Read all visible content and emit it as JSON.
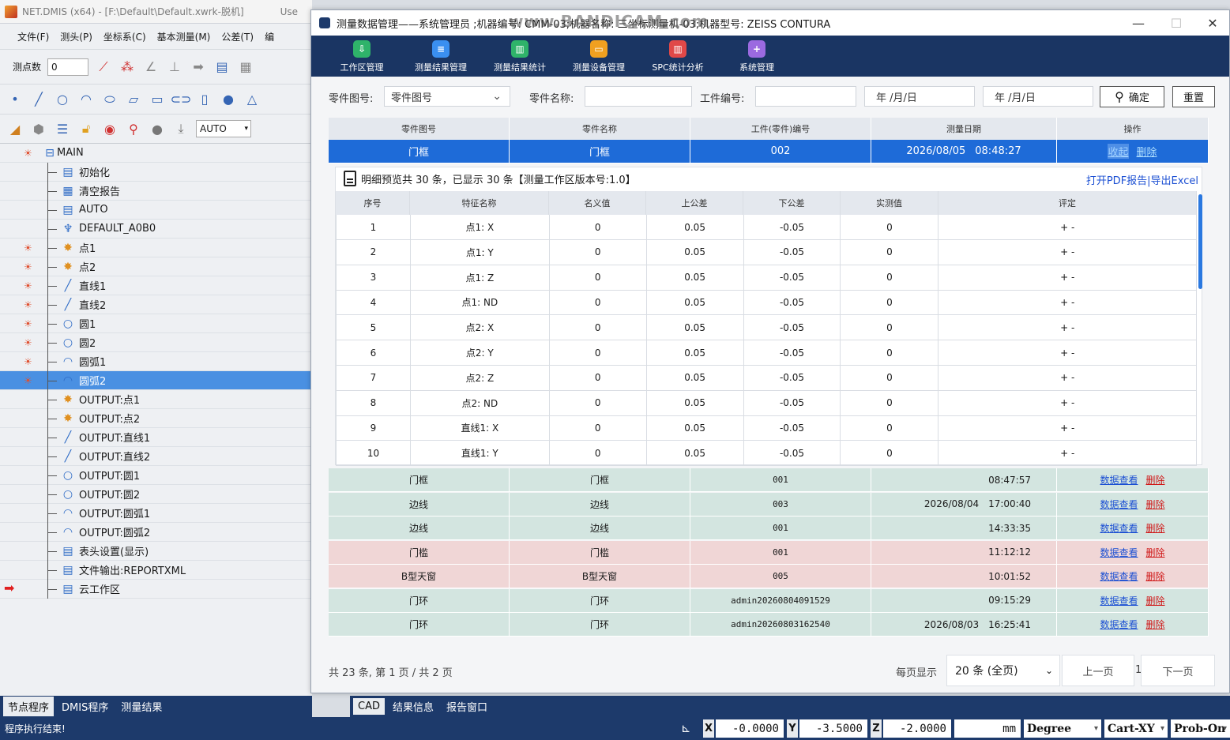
{
  "app": {
    "title": "NET.DMIS (x64) - [F:\\Default\\Default.xwrk-脱机]",
    "title_tail": "Use",
    "menu": [
      "文件(F)",
      "测头(P)",
      "坐标系(C)",
      "基本测量(M)",
      "公差(T)",
      "编"
    ],
    "toolbar": {
      "point_count_label": "测点数",
      "point_count_value": "0",
      "auto_value": "AUTO"
    }
  },
  "tree": {
    "items": [
      {
        "label": "MAIN",
        "icon": "minus-box-icon"
      },
      {
        "label": "初始化",
        "icon": "init-icon"
      },
      {
        "label": "清空报告",
        "icon": "clear-report-icon"
      },
      {
        "label": "AUTO",
        "icon": "mode-icon"
      },
      {
        "label": "DEFAULT_A0B0",
        "icon": "probe-icon"
      },
      {
        "label": "点1",
        "icon": "point-icon"
      },
      {
        "label": "点2",
        "icon": "point-icon"
      },
      {
        "label": "直线1",
        "icon": "line-icon"
      },
      {
        "label": "直线2",
        "icon": "line-icon"
      },
      {
        "label": "圆1",
        "icon": "circle-icon"
      },
      {
        "label": "圆2",
        "icon": "circle-icon"
      },
      {
        "label": "圆弧1",
        "icon": "arc-icon"
      },
      {
        "label": "圆弧2",
        "icon": "arc-icon"
      },
      {
        "label": "OUTPUT:点1",
        "icon": "point-icon"
      },
      {
        "label": "OUTPUT:点2",
        "icon": "point-icon"
      },
      {
        "label": "OUTPUT:直线1",
        "icon": "line-icon"
      },
      {
        "label": "OUTPUT:直线2",
        "icon": "line-icon"
      },
      {
        "label": "OUTPUT:圆1",
        "icon": "circle-icon"
      },
      {
        "label": "OUTPUT:圆2",
        "icon": "circle-icon"
      },
      {
        "label": "OUTPUT:圆弧1",
        "icon": "arc-icon"
      },
      {
        "label": "OUTPUT:圆弧2",
        "icon": "arc-icon"
      },
      {
        "label": "表头设置(显示)",
        "icon": "header-icon"
      },
      {
        "label": "文件输出:REPORTXML",
        "icon": "file-output-icon"
      },
      {
        "label": "云工作区",
        "icon": "cloud-icon"
      }
    ]
  },
  "bottom_tabs_left": [
    "节点程序",
    "DMIS程序",
    "测量结果"
  ],
  "bottom_tabs_right": [
    "CAD",
    "结果信息",
    "报告窗口"
  ],
  "status": {
    "message": "程序执行结束!",
    "x_label": "X",
    "x_value": "-0.0000",
    "y_label": "Y",
    "y_value": "-3.5000",
    "z_label": "Z",
    "z_value": "-2.0000",
    "unit": "mm",
    "angle": "Degree",
    "coord": "Cart-XY",
    "probe": "Prob-On"
  },
  "dialog": {
    "title": "测量数据管理——系统管理员 ;机器编号: CMM-03;机器名称: 三坐标测量机-03;机器型号: ZEISS CONTURA",
    "watermark": "www.BANDICAM.com",
    "toolbar": [
      {
        "label": "工作区管理",
        "color": "#2fb36a",
        "icon": "⇩"
      },
      {
        "label": "测量结果管理",
        "color": "#3a8ff0",
        "icon": "≡"
      },
      {
        "label": "测量结果统计",
        "color": "#2fb36a",
        "icon": "▥"
      },
      {
        "label": "测量设备管理",
        "color": "#f0a020",
        "icon": "▭"
      },
      {
        "label": "SPC统计分析",
        "color": "#e04848",
        "icon": "▥"
      },
      {
        "label": "系统管理",
        "color": "#9b6ae0",
        "icon": "+"
      }
    ],
    "filter": {
      "part_no_label": "零件图号:",
      "part_no_placeholder": "零件图号",
      "part_name_label": "零件名称:",
      "work_no_label": "工件编号:",
      "date_from": "年 /月/日",
      "date_to": "年 /月/日",
      "confirm": "确定",
      "reset": "重置"
    },
    "table": {
      "headers": [
        "零件图号",
        "零件名称",
        "工件(零件)编号",
        "测量日期",
        "操作"
      ],
      "selected": {
        "part_no": "门框",
        "part_name": "门框",
        "work_no": "002",
        "date": "2026/08/05",
        "time": "08:48:27",
        "collapse": "收起",
        "delete": "删除"
      },
      "rows": [
        {
          "part_no": "门框",
          "part_name": "门框",
          "work_no": "001",
          "date": "",
          "time": "08:47:57",
          "status": "green"
        },
        {
          "part_no": "边线",
          "part_name": "边线",
          "work_no": "003",
          "date": "2026/08/04",
          "time": "17:00:40",
          "status": "green"
        },
        {
          "part_no": "边线",
          "part_name": "边线",
          "work_no": "001",
          "date": "",
          "time": "14:33:35",
          "status": "green"
        },
        {
          "part_no": "门槛",
          "part_name": "门槛",
          "work_no": "001",
          "date": "",
          "time": "11:12:12",
          "status": "pink"
        },
        {
          "part_no": "B型天窗",
          "part_name": "B型天窗",
          "work_no": "005",
          "date": "",
          "time": "10:01:52",
          "status": "pink"
        },
        {
          "part_no": "门环",
          "part_name": "门环",
          "work_no": "admin20260804091529",
          "date": "",
          "time": "09:15:29",
          "status": "green"
        },
        {
          "part_no": "门环",
          "part_name": "门环",
          "work_no": "admin20260803162540",
          "date": "2026/08/03",
          "time": "16:25:41",
          "status": "green"
        }
      ],
      "view_label": "数据查看",
      "delete_label": "删除"
    },
    "detail": {
      "summary": "明细预览共 30 条，已显示 30 条【测量工作区版本号:1.0】",
      "links": "打开PDF报告|导出Excel",
      "headers": [
        "序号",
        "特征名称",
        "名义值",
        "上公差",
        "下公差",
        "实测值",
        "评定"
      ],
      "rows": [
        [
          "1",
          "点1: X",
          "0",
          "0.05",
          "-0.05",
          "0",
          "+ -"
        ],
        [
          "2",
          "点1: Y",
          "0",
          "0.05",
          "-0.05",
          "0",
          "+ -"
        ],
        [
          "3",
          "点1: Z",
          "0",
          "0.05",
          "-0.05",
          "0",
          "+ -"
        ],
        [
          "4",
          "点1: ND",
          "0",
          "0.05",
          "-0.05",
          "0",
          "+ -"
        ],
        [
          "5",
          "点2: X",
          "0",
          "0.05",
          "-0.05",
          "0",
          "+ -"
        ],
        [
          "6",
          "点2: Y",
          "0",
          "0.05",
          "-0.05",
          "0",
          "+ -"
        ],
        [
          "7",
          "点2: Z",
          "0",
          "0.05",
          "-0.05",
          "0",
          "+ -"
        ],
        [
          "8",
          "点2: ND",
          "0",
          "0.05",
          "-0.05",
          "0",
          "+ -"
        ],
        [
          "9",
          "直线1: X",
          "0",
          "0.05",
          "-0.05",
          "0",
          "+ -"
        ],
        [
          "10",
          "直线1: Y",
          "0",
          "0.05",
          "-0.05",
          "0",
          "+ -"
        ]
      ]
    },
    "pager": {
      "summary": "共 23 条, 第 1 页 / 共 2 页",
      "per_page_label": "每页显示",
      "per_page_value": "20 条 (全页)",
      "prev": "上一页",
      "page": "1",
      "next": "下一页"
    }
  }
}
